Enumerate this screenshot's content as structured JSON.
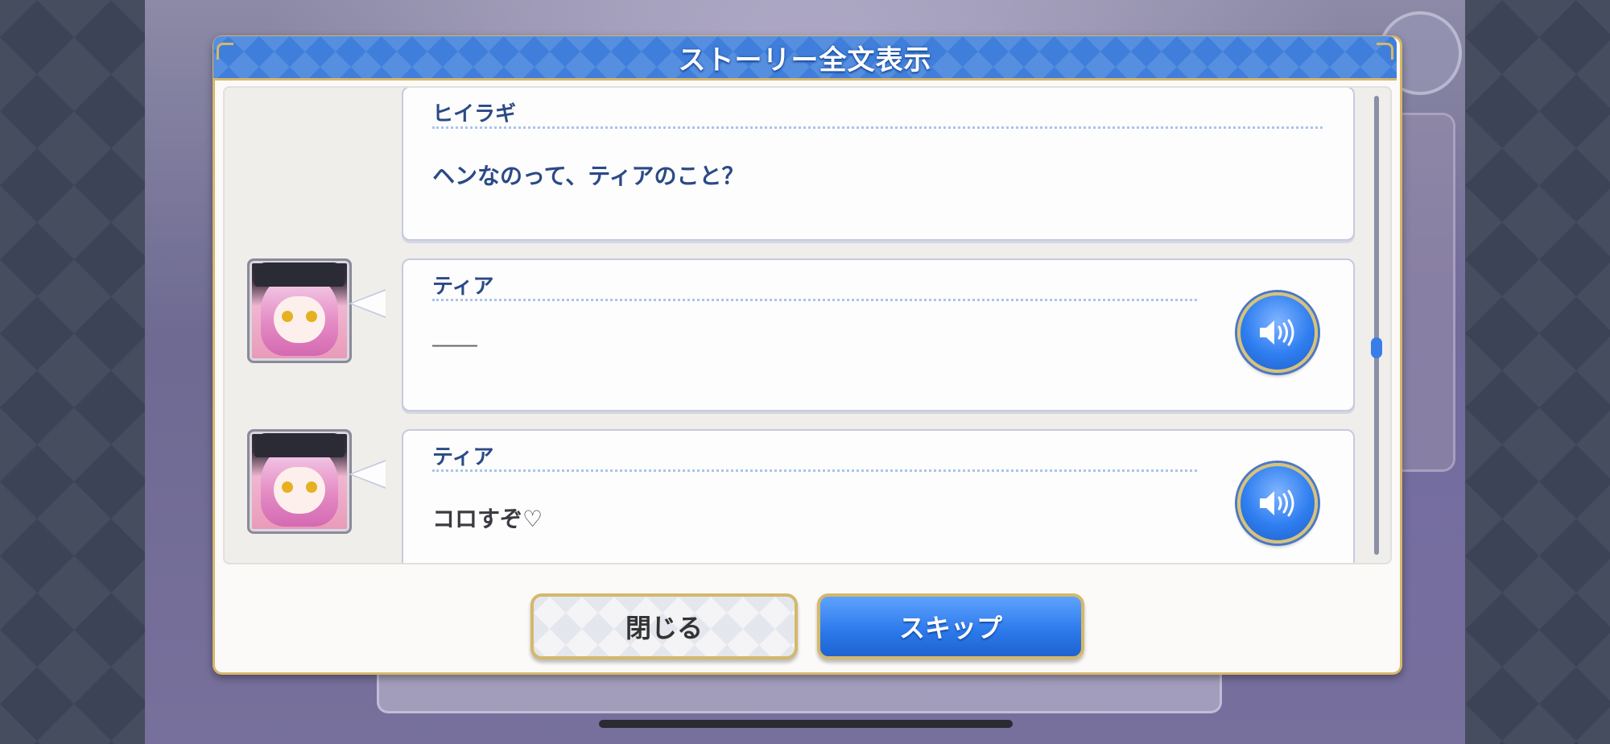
{
  "dialog": {
    "title": "ストーリー全文表示",
    "entries": [
      {
        "speaker": "ヒイラギ",
        "text": "ヘンなのって、ティアのこと？",
        "has_portrait": false,
        "has_voice": false
      },
      {
        "speaker": "ティア",
        "text": "――",
        "has_portrait": true,
        "has_voice": true
      },
      {
        "speaker": "ティア",
        "text": "コロすぞ♡",
        "has_portrait": true,
        "has_voice": true
      }
    ],
    "buttons": {
      "close_label": "閉じる",
      "skip_label": "スキップ"
    }
  },
  "colors": {
    "accent_blue": "#2f7ef0",
    "gold_border": "#d7b76a",
    "speaker_text": "#2b4a86"
  },
  "icons": {
    "voice": "speaker-volume-icon"
  }
}
